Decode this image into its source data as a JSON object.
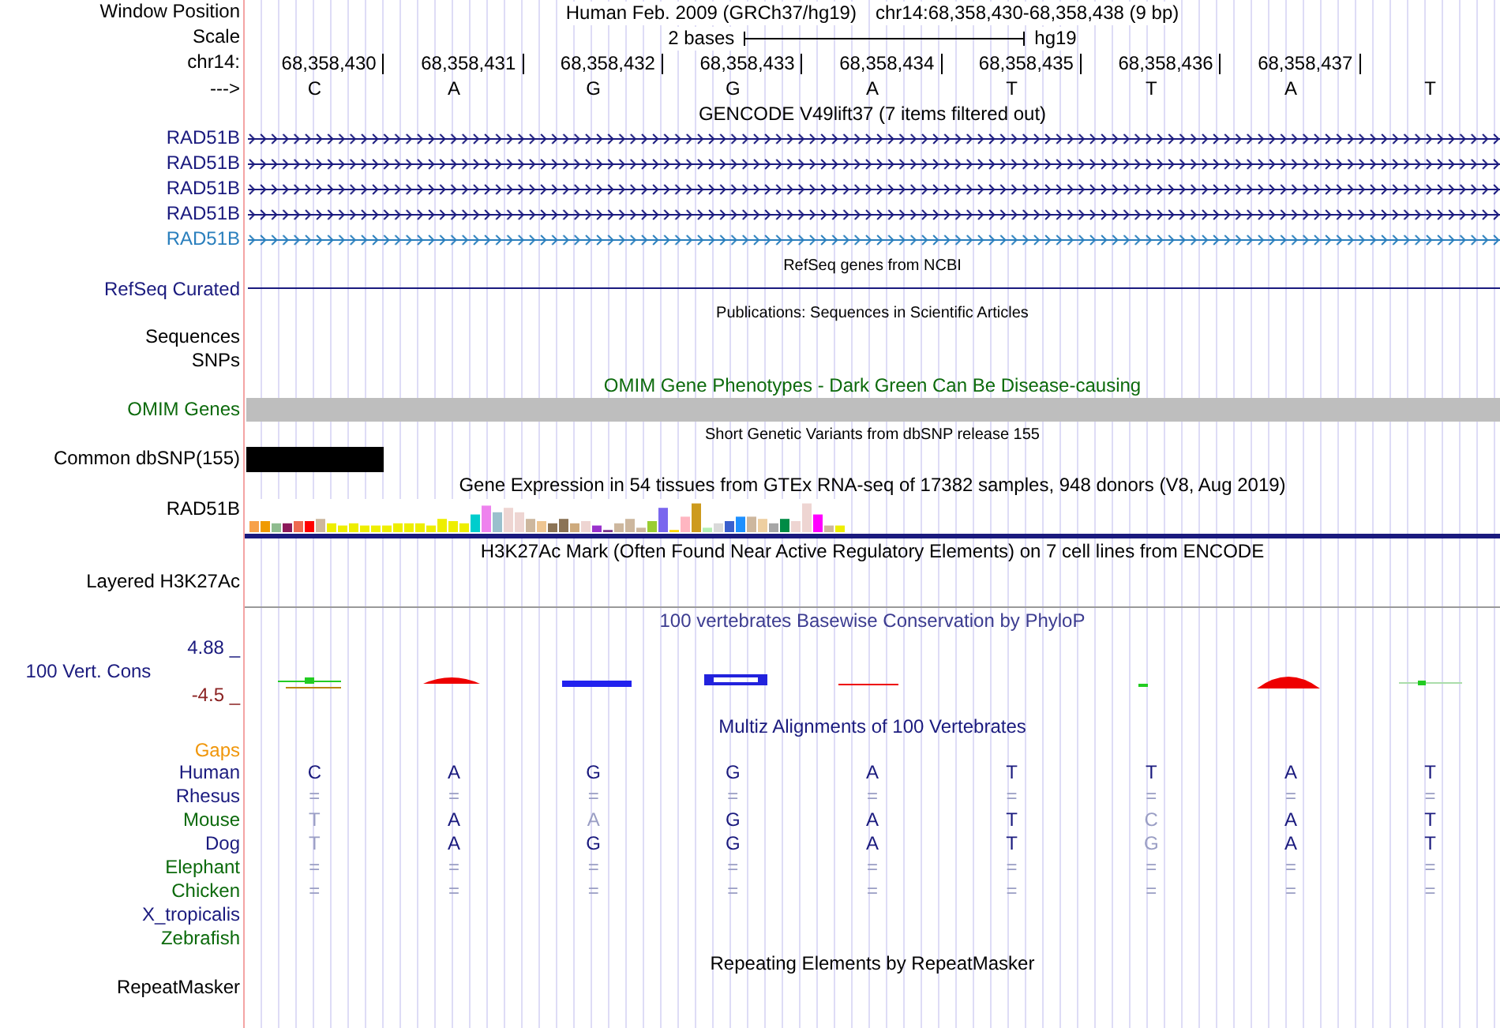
{
  "position": {
    "label": "Window Position",
    "assembly": "Human Feb. 2009 (GRCh37/hg19)",
    "range": "chr14:68,358,430-68,358,438 (9 bp)"
  },
  "scale": {
    "label": "Scale",
    "span": "2 bases",
    "assembly": "hg19"
  },
  "ruler": {
    "label": "chr14:",
    "ticks": [
      "68,358,430",
      "68,358,431",
      "68,358,432",
      "68,358,433",
      "68,358,434",
      "68,358,435",
      "68,358,436",
      "68,358,437"
    ]
  },
  "sequence": {
    "label": "--->",
    "bases": [
      "C",
      "A",
      "G",
      "G",
      "A",
      "T",
      "T",
      "A",
      "T"
    ]
  },
  "tracks": [
    {
      "kind": "genes",
      "title": "GENCODE V49lift37 (7 items filtered out)",
      "items": [
        {
          "label": "RAD51B",
          "color": "#1a1a7e"
        },
        {
          "label": "RAD51B",
          "color": "#1a1a7e"
        },
        {
          "label": "RAD51B",
          "color": "#1a1a7e"
        },
        {
          "label": "RAD51B",
          "color": "#1a1a7e"
        },
        {
          "label": "RAD51B",
          "color": "#2a7fbd"
        }
      ]
    },
    {
      "kind": "line",
      "title": "RefSeq genes from NCBI",
      "label": "RefSeq Curated"
    },
    {
      "kind": "empty",
      "title": "Publications: Sequences in Scientific Articles",
      "labels": [
        "Sequences",
        "SNPs"
      ]
    },
    {
      "kind": "omim",
      "title": "OMIM Gene Phenotypes - Dark Green Can Be Disease-causing",
      "label": "OMIM Genes"
    },
    {
      "kind": "snp",
      "title": "Short Genetic Variants from dbSNP release 155",
      "label": "Common dbSNP(155)"
    },
    {
      "kind": "expression",
      "title": "Gene Expression in 54 tissues from GTEx RNA-seq of 17382 samples, 948 donors (V8, Aug 2019)",
      "label": "RAD51B"
    },
    {
      "kind": "layered",
      "title": "H3K27Ac Mark (Often Found Near Active Regulatory Elements) on 7 cell lines from ENCODE",
      "label": "Layered H3K27Ac"
    },
    {
      "kind": "conservation",
      "title": "100 vertebrates Basewise Conservation by PhyloP",
      "label": "100 Vert. Cons",
      "max": "4.88 _",
      "min": "-4.5 _"
    },
    {
      "kind": "multiz",
      "title": "Multiz Alignments of 100 Vertebrates",
      "gaps": "Gaps",
      "species": [
        {
          "label": "Human",
          "color": "#1a1a7e",
          "bases": [
            {
              "text": "C",
              "faded": false
            },
            {
              "text": "A",
              "faded": false
            },
            {
              "text": "G",
              "faded": false
            },
            {
              "text": "G",
              "faded": false
            },
            {
              "text": "A",
              "faded": false
            },
            {
              "text": "T",
              "faded": false
            },
            {
              "text": "T",
              "faded": false
            },
            {
              "text": "A",
              "faded": false
            },
            {
              "text": "T",
              "faded": false
            }
          ]
        },
        {
          "label": "Rhesus",
          "color": "#1a1a7e",
          "bases": [
            {
              "text": "=",
              "faded": true
            },
            {
              "text": "=",
              "faded": true
            },
            {
              "text": "=",
              "faded": true
            },
            {
              "text": "=",
              "faded": true
            },
            {
              "text": "=",
              "faded": true
            },
            {
              "text": "=",
              "faded": true
            },
            {
              "text": "=",
              "faded": true
            },
            {
              "text": "=",
              "faded": true
            },
            {
              "text": "=",
              "faded": true
            }
          ]
        },
        {
          "label": "Mouse",
          "color": "#0c6a0c",
          "bases": [
            {
              "text": "T",
              "faded": true
            },
            {
              "text": "A",
              "faded": false
            },
            {
              "text": "A",
              "faded": true
            },
            {
              "text": "G",
              "faded": false
            },
            {
              "text": "A",
              "faded": false
            },
            {
              "text": "T",
              "faded": false
            },
            {
              "text": "C",
              "faded": true
            },
            {
              "text": "A",
              "faded": false
            },
            {
              "text": "T",
              "faded": false
            }
          ]
        },
        {
          "label": "Dog",
          "color": "#1a1a7e",
          "bases": [
            {
              "text": "T",
              "faded": true
            },
            {
              "text": "A",
              "faded": false
            },
            {
              "text": "G",
              "faded": false
            },
            {
              "text": "G",
              "faded": false
            },
            {
              "text": "A",
              "faded": false
            },
            {
              "text": "T",
              "faded": false
            },
            {
              "text": "G",
              "faded": true
            },
            {
              "text": "A",
              "faded": false
            },
            {
              "text": "T",
              "faded": false
            }
          ]
        },
        {
          "label": "Elephant",
          "color": "#0c6a0c",
          "bases": [
            {
              "text": "=",
              "faded": true
            },
            {
              "text": "=",
              "faded": true
            },
            {
              "text": "=",
              "faded": true
            },
            {
              "text": "=",
              "faded": true
            },
            {
              "text": "=",
              "faded": true
            },
            {
              "text": "=",
              "faded": true
            },
            {
              "text": "=",
              "faded": true
            },
            {
              "text": "=",
              "faded": true
            },
            {
              "text": "=",
              "faded": true
            }
          ]
        },
        {
          "label": "Chicken",
          "color": "#0c6a0c",
          "bases": [
            {
              "text": "=",
              "faded": true
            },
            {
              "text": "=",
              "faded": true
            },
            {
              "text": "=",
              "faded": true
            },
            {
              "text": "=",
              "faded": true
            },
            {
              "text": "=",
              "faded": true
            },
            {
              "text": "=",
              "faded": true
            },
            {
              "text": "=",
              "faded": true
            },
            {
              "text": "=",
              "faded": true
            },
            {
              "text": "=",
              "faded": true
            }
          ]
        },
        {
          "label": "X_tropicalis",
          "color": "#1a1a7e"
        },
        {
          "label": "Zebrafish",
          "color": "#0c6a0c"
        }
      ]
    },
    {
      "kind": "repeat",
      "title": "Repeating Elements by RepeatMasker",
      "label": "RepeatMasker"
    }
  ]
}
